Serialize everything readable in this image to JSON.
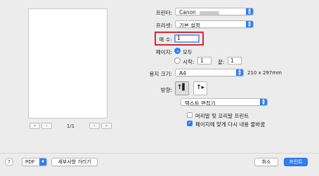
{
  "colors": {
    "accent": "#2f7ef6",
    "highlight_box": "#d8262c"
  },
  "preview": {
    "page_indicator": "1/1",
    "nav_first": "«",
    "nav_prev": "‹",
    "nav_next": "›",
    "nav_last": "»"
  },
  "printer": {
    "label": "프린터:",
    "value": "Canon"
  },
  "preset": {
    "label": "프리셋:",
    "value": "기본 설정"
  },
  "copies": {
    "label": "매 수:",
    "value": "1"
  },
  "pages": {
    "label": "페이지:",
    "all_label": "모두",
    "all_selected": true,
    "from_label": "시작:",
    "from_value": "1",
    "to_label": "끝:",
    "to_value": "1"
  },
  "paper_size": {
    "label": "용지 크기:",
    "value": "A4",
    "dimensions": "210 x 297mm"
  },
  "orientation": {
    "label": "방향:",
    "selected": "portrait",
    "icons": [
      "portrait-orientation-icon",
      "landscape-orientation-icon"
    ]
  },
  "app_section": {
    "value": "텍스트 편집기"
  },
  "options": [
    {
      "label": "머리말 및 꼬리말 프린트",
      "checked": false
    },
    {
      "label": "페이지에 맞게 다시 내용 줄바꿈",
      "checked": true
    }
  ],
  "footer": {
    "help": "?",
    "pdf": "PDF",
    "hide_details": "세부사항 가리기",
    "cancel": "취소",
    "print": "프린트"
  }
}
